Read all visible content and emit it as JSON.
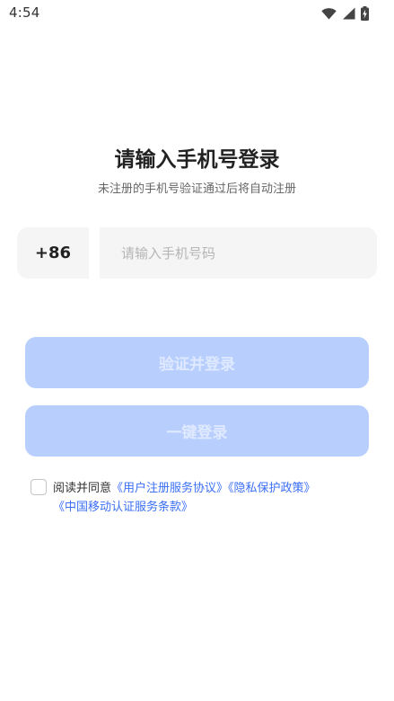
{
  "status_bar": {
    "time": "4:54",
    "icons": [
      "wifi-icon",
      "cellular-signal-icon",
      "battery-charging-icon"
    ]
  },
  "login": {
    "title": "请输入手机号登录",
    "subtitle": "未注册的手机号验证通过后将自动注册",
    "country_code": "+86",
    "phone_placeholder": "请输入手机号码",
    "phone_value": "",
    "verify_button": "验证并登录",
    "onekey_button": "一键登录"
  },
  "agreement": {
    "checked": false,
    "prefix": "阅读并同意",
    "links": [
      "《用户注册服务协议》",
      "《隐私保护政策》",
      "《中国移动认证服务条款》"
    ]
  },
  "colors": {
    "button_disabled_bg": "#b8cffe",
    "button_disabled_text": "#dfe9ff",
    "link": "#3b6ff5",
    "input_bg": "#f5f5f5"
  }
}
